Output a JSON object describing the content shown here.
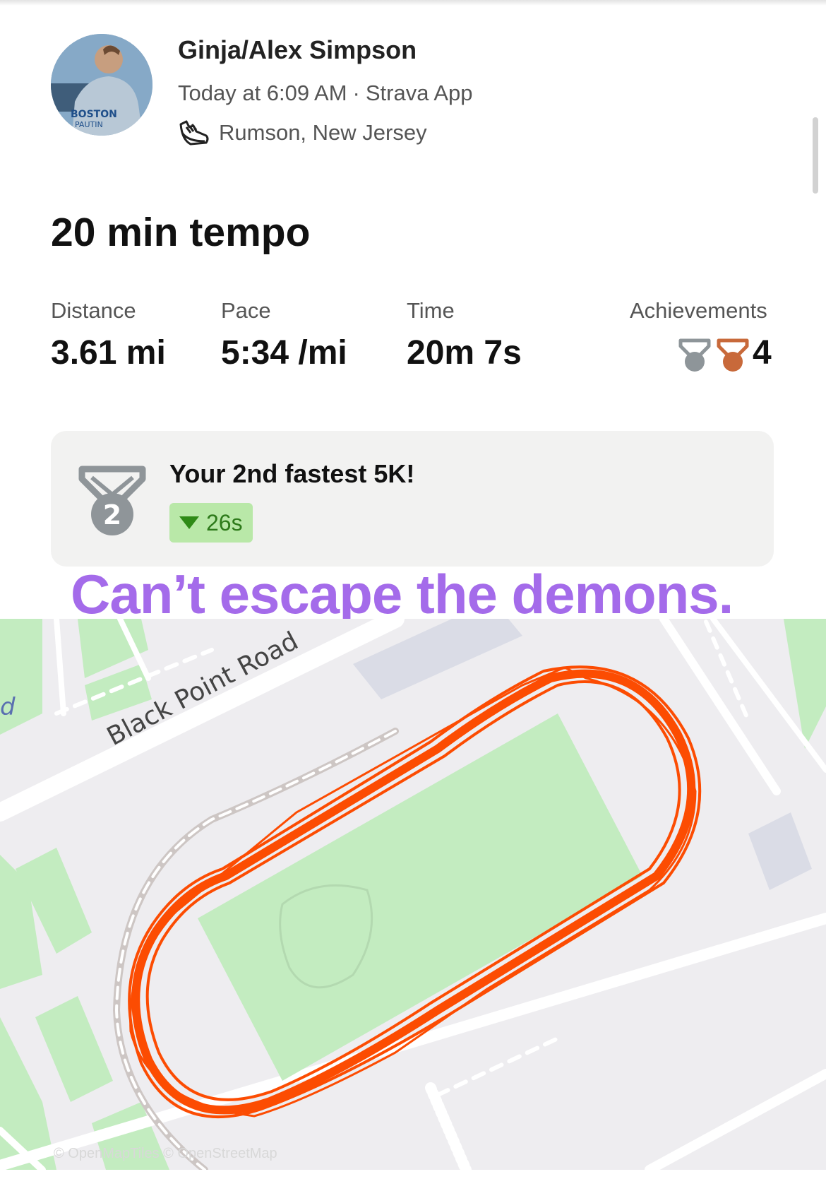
{
  "activity": {
    "athlete_name": "Ginja/Alex Simpson",
    "timestamp": "Today at 6:09 AM",
    "source": "Strava App",
    "location": "Rumson, New Jersey",
    "location_icon": "running-shoe-icon",
    "title": "20 min tempo"
  },
  "stats": {
    "distance_label": "Distance",
    "distance_value": "3.61 mi",
    "pace_label": "Pace",
    "pace_value": "5:34 /mi",
    "time_label": "Time",
    "time_value": "20m 7s",
    "achievements_label": "Achievements",
    "achievements_count": "4",
    "achievement_icons": [
      "silver-medal-icon",
      "bronze-medal-icon"
    ]
  },
  "highlight": {
    "headline": "Your 2nd fastest 5K!",
    "medal_rank": "2",
    "delta": "26s"
  },
  "caption": "Can’t escape the demons.",
  "map": {
    "road_label": "Black Point Road",
    "partial_label": "d",
    "attribution": "© OpenMapTiles © OpenStreetMap",
    "route_color": "#fc4c02",
    "field_color": "#c3ecc0",
    "background_color": "#eeedf0"
  },
  "colors": {
    "caption": "#a46bea",
    "badge_bg": "#b9e8a8",
    "badge_text": "#2d7a1a",
    "silver": "#8e9599",
    "bronze": "#c8693a"
  }
}
